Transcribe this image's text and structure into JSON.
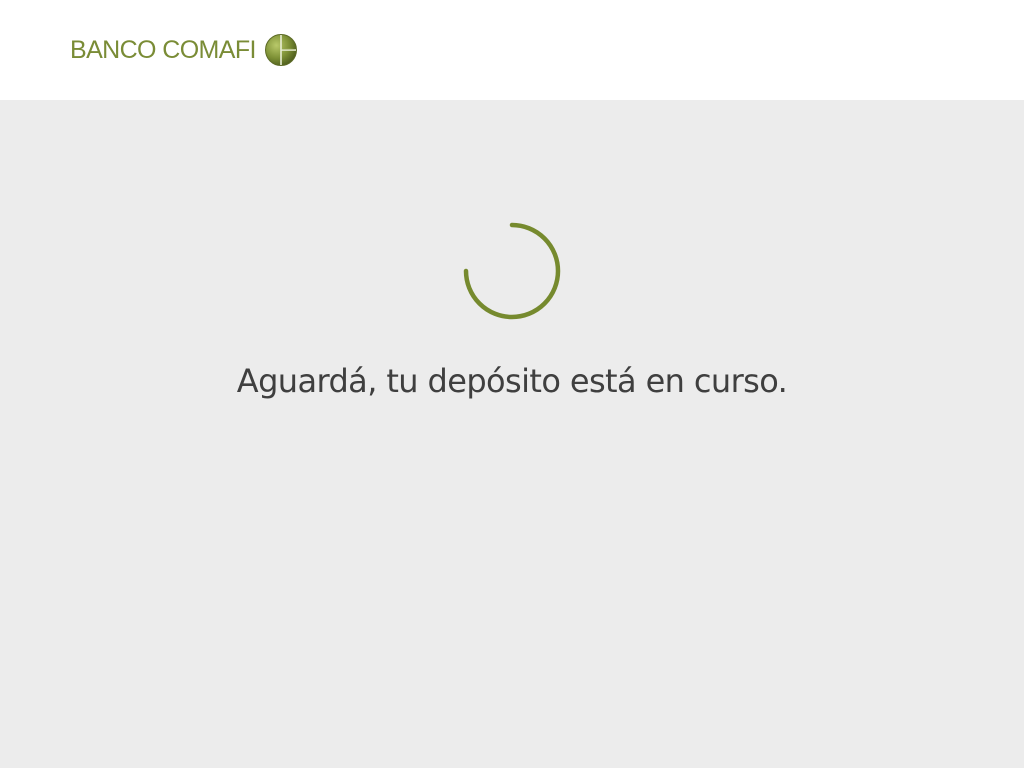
{
  "header": {
    "logo_text": "BANCO COMAFI",
    "logo_icon": "globe-icon"
  },
  "main": {
    "spinner_icon": "loading-spinner-icon",
    "message": "Aguardá, tu depósito está en curso."
  },
  "colors": {
    "brand_green": "#7a8c36",
    "spinner_green": "#768a2e",
    "background": "#ececec",
    "header_background": "#ffffff",
    "text": "#3f3f3f"
  }
}
